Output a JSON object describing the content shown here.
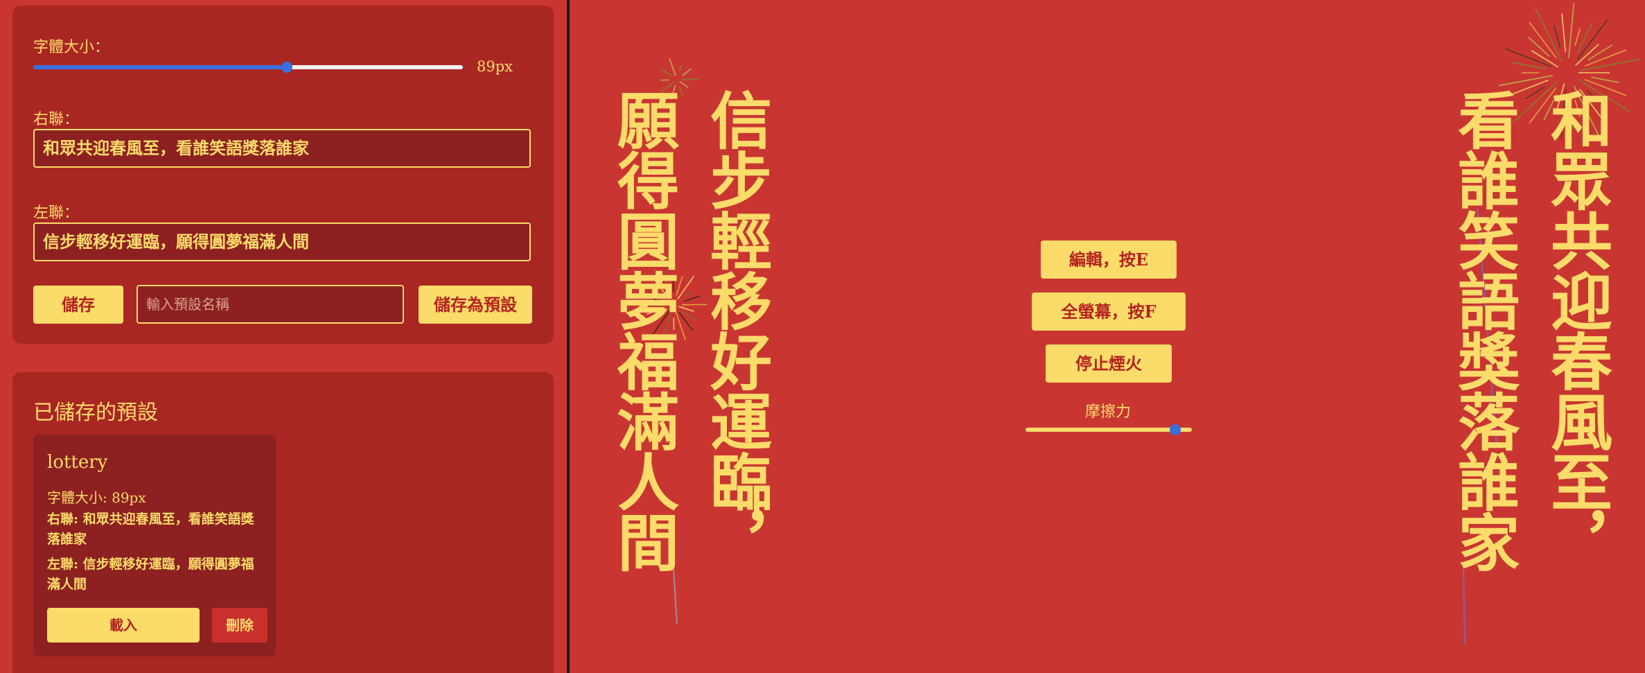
{
  "editor": {
    "font_size_label": "字體大小：",
    "font_size_value": "89px",
    "font_size_fraction": 0.59,
    "right_couplet_label": "右聯：",
    "right_couplet_value": "和眾共迎春風至，看誰笑語獎落誰家",
    "left_couplet_label": "左聯：",
    "left_couplet_value": "信步輕移好運臨，願得圓夢福滿人間",
    "save_label": "儲存",
    "preset_name_placeholder": "輸入預設名稱",
    "save_preset_label": "儲存為預設"
  },
  "presets": {
    "title": "已儲存的預設",
    "items": [
      {
        "name": "lottery",
        "font_size": "字體大小: 89px",
        "right": "右聯: 和眾共迎春風至，看誰笑語獎落誰家",
        "left": "左聯: 信步輕移好運臨，願得圓夢福滿人間",
        "load_label": "載入",
        "delete_label": "刪除"
      }
    ]
  },
  "display": {
    "left_couplet_col1": "信步輕移好運臨，",
    "left_couplet_col2": "願得圓夢福滿人間",
    "right_couplet_col1": "和眾共迎春風至，",
    "right_couplet_col2": "看誰笑語獎落誰家",
    "edit_button": "編輯，按E",
    "fullscreen_button": "全螢幕，按F",
    "stop_fireworks_button": "停止煙火",
    "friction_label": "摩擦力",
    "friction_fraction": 0.9
  },
  "colors": {
    "background": "#c93632",
    "panel": "#a82723",
    "input_bg": "#8d2121",
    "gold": "#fbdc6a",
    "text_red": "#b4231f",
    "slider_blue": "#3b6fe0"
  }
}
